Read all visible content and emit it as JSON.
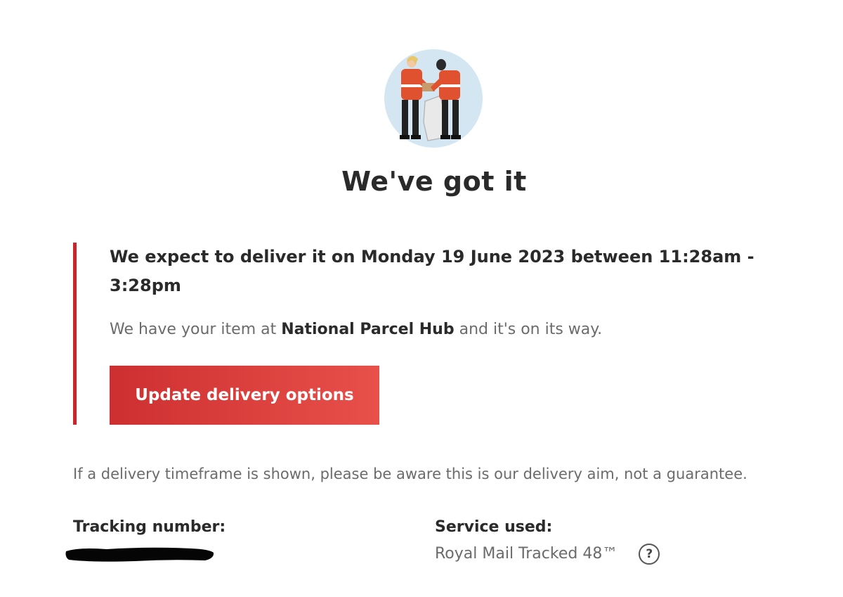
{
  "page": {
    "title": "We've got it"
  },
  "notice": {
    "headline": "We expect to deliver it on Monday 19 June 2023 between 11:28am - 3:28pm",
    "body_prefix": "We have your item at ",
    "location": "National Parcel Hub",
    "body_suffix": " and it's on its way.",
    "accent_color": "#c8262a"
  },
  "actions": {
    "update_label": "Update delivery options"
  },
  "disclaimer": "If a delivery timeframe is shown, please be aware this is our delivery aim, not a guarantee.",
  "tracking": {
    "label": "Tracking number:"
  },
  "service": {
    "label": "Service used:",
    "value": "Royal Mail Tracked 48™",
    "help_glyph": "?"
  },
  "icons": {
    "hero": "postal-workers-illustration",
    "help": "question-circle-icon"
  },
  "colors": {
    "brand_red": "#c8262a",
    "button_gradient_start": "#cd2f30",
    "button_gradient_end": "#e8504a",
    "heading_text": "#2a2a2a",
    "body_text": "#6b6b6b"
  }
}
